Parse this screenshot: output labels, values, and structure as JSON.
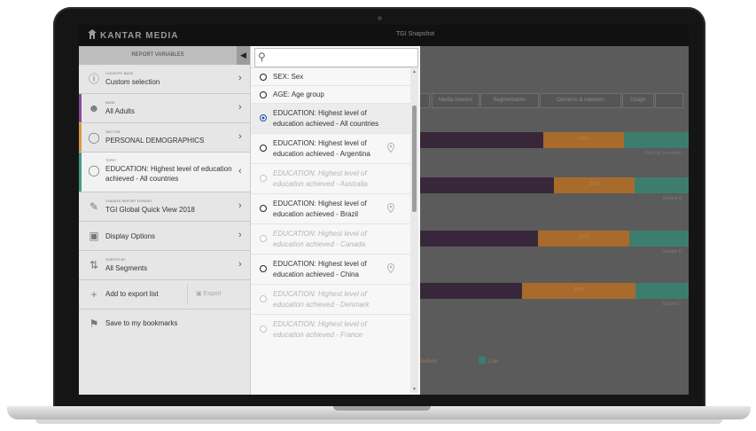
{
  "app": {
    "logo_text": "KANTAR MEDIA",
    "title": "TGI Snapshot"
  },
  "colors": {
    "purple": "#38273a",
    "orange": "#a86b2c",
    "teal": "#3d7d6e",
    "selected_radio": "#1e5aa8"
  },
  "left_panel": {
    "header": "REPORT VARIABLES",
    "collapse_icon": "chevron-left-icon",
    "items": [
      {
        "caption": "COUNTRY BASE",
        "value": "Custom selection",
        "icon": "globe-icon",
        "accent": ""
      },
      {
        "caption": "BASE",
        "value": "All Adults",
        "icon": "person-icon",
        "accent": "#8a4a9b"
      },
      {
        "caption": "SECTOR",
        "value": "PERSONAL DEMOGRAPHICS",
        "icon": "category-icon",
        "accent": "#d69a3c"
      },
      {
        "caption": "TOPIC",
        "value": "EDUCATION: Highest level of education achieved - All countries",
        "icon": "topic-icon",
        "accent": "#3f9c8a"
      },
      {
        "caption": "CHANGE REPORT FORMAT",
        "value": "TGI Global Quick View 2018",
        "icon": "edit-icon",
        "accent": ""
      },
      {
        "caption": "",
        "value": "Display Options",
        "icon": "display-icon",
        "accent": ""
      },
      {
        "caption": "SORTED BY",
        "value": "All Segments",
        "icon": "sort-icon",
        "accent": ""
      }
    ],
    "add_to_export": "Add to export list",
    "export": "Export",
    "save_bookmarks": "Save to my bookmarks"
  },
  "dropdown": {
    "search_value": "",
    "options": [
      {
        "text": "SEX: Sex",
        "state": "normal",
        "pin": false
      },
      {
        "text": "AGE: Age group",
        "state": "normal",
        "pin": false
      },
      {
        "text": "EDUCATION: Highest level of education achieved - All countries",
        "state": "selected",
        "pin": false
      },
      {
        "text": "EDUCATION: Highest level of education achieved - Argentina",
        "state": "normal",
        "pin": true
      },
      {
        "text": "EDUCATION: Highest level of education achieved - Australia",
        "state": "disabled",
        "pin": false
      },
      {
        "text": "EDUCATION: Highest level of education achieved - Brazil",
        "state": "normal",
        "pin": true
      },
      {
        "text": "EDUCATION: Highest level of education achieved - Canada",
        "state": "disabled",
        "pin": false
      },
      {
        "text": "EDUCATION: Highest level of education achieved - China",
        "state": "normal",
        "pin": true
      },
      {
        "text": "EDUCATION: Highest level of education achieved - Denmark",
        "state": "disabled",
        "pin": false
      },
      {
        "text": "EDUCATION: Highest level of education achieved - France",
        "state": "disabled",
        "pin": false
      }
    ]
  },
  "background": {
    "tabs": [
      "",
      "Media Interest",
      "Segmentation",
      "Opinions & interests",
      "Usage"
    ],
    "rows": [
      {
        "values": [
          46,
          30,
          24
        ],
        "label": "29%",
        "note": "Total (all countries)"
      },
      {
        "values": [
          50,
          30,
          20
        ],
        "label": "31%",
        "note": "Sample A"
      },
      {
        "values": [
          44,
          34,
          22
        ],
        "label": "33%",
        "note": "Sample B"
      },
      {
        "values": [
          38,
          42,
          20
        ],
        "label": "39%",
        "note": "Sample C"
      }
    ],
    "legend": [
      "Medium",
      "Low"
    ]
  }
}
